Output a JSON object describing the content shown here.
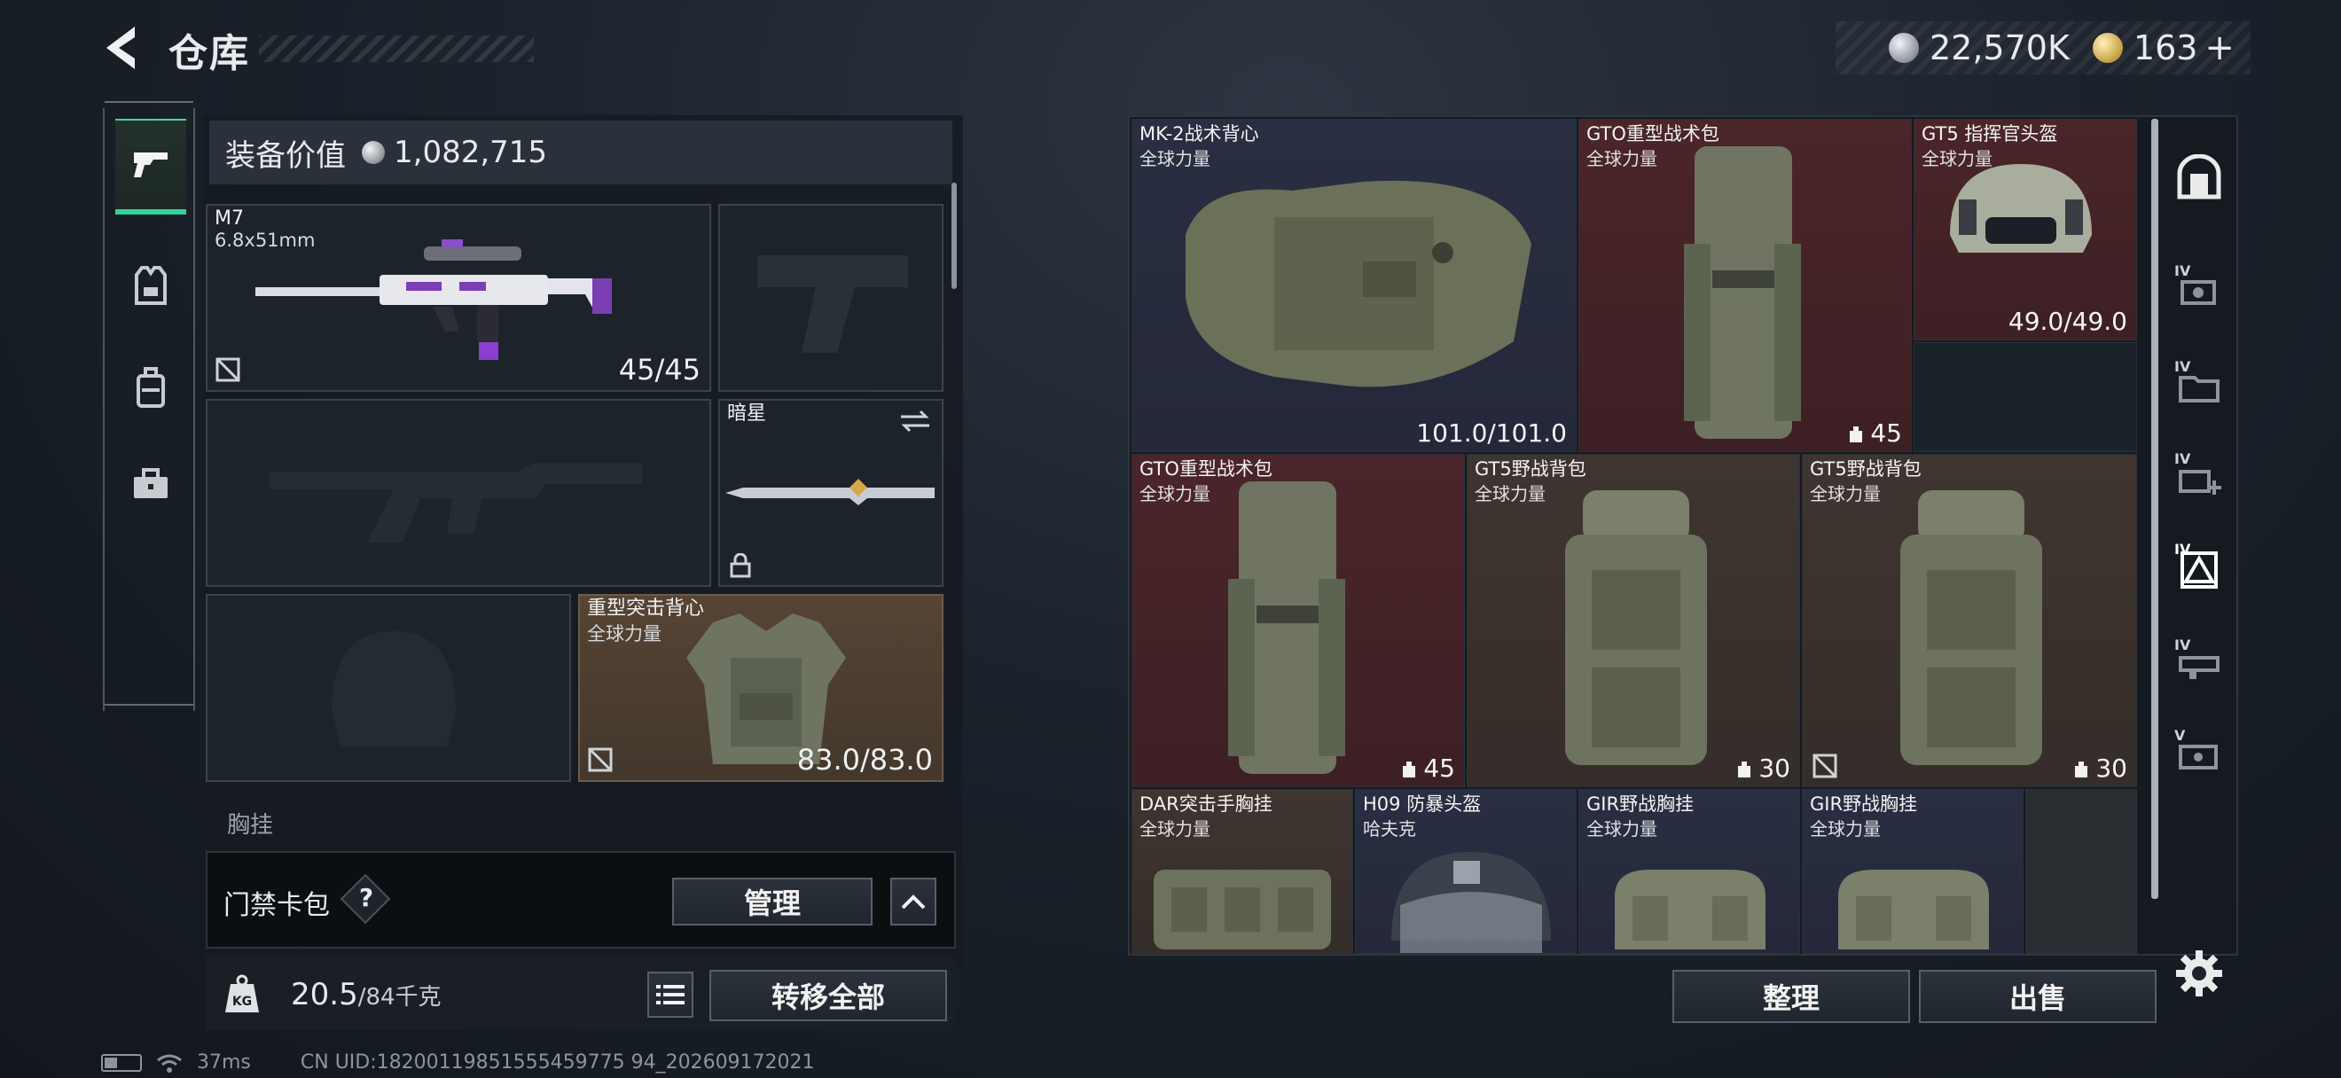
{
  "header": {
    "title": "仓库",
    "currency": [
      {
        "icon": "silver-coin-icon",
        "value": "22,570K"
      },
      {
        "icon": "gold-coin-icon",
        "value": "163"
      },
      {
        "icon": "plus-icon",
        "value": "+"
      }
    ]
  },
  "left_tabs": [
    {
      "icon": "pistol-icon",
      "active": true
    },
    {
      "icon": "vest-icon",
      "active": false
    },
    {
      "icon": "backpack-icon",
      "active": false
    },
    {
      "icon": "toolbox-icon",
      "active": false
    }
  ],
  "loadout": {
    "equip_value_label": "装备价值",
    "equip_value": "1,082,715",
    "primary": {
      "name": "M7",
      "caliber": "6.8x51mm",
      "ammo": "45/45"
    },
    "melee": {
      "name": "暗星"
    },
    "armor": {
      "name": "重型突击背心",
      "sub": "全球力量",
      "durability": "83.0/83.0"
    },
    "peek_label": "胸挂",
    "access_card_label": "门禁卡包",
    "help": "?",
    "manage_button": "管理",
    "weight_value": "20.5",
    "weight_max": "/84千克",
    "transfer_button": "转移全部"
  },
  "storage": {
    "items": [
      {
        "name": "MK-2战术背心",
        "sub": "全球力量",
        "durability": "101.0/101.0",
        "color": "blue"
      },
      {
        "name": "GTO重型战术包",
        "sub": "全球力量",
        "capacity": "45",
        "color": "red"
      },
      {
        "name": "GT5 指挥官头盔",
        "sub": "全球力量",
        "durability": "49.0/49.0",
        "color": "red"
      },
      {
        "name": "GTO重型战术包",
        "sub": "全球力量",
        "capacity": "45",
        "color": "red"
      },
      {
        "name": "GT5野战背包",
        "sub": "全球力量",
        "capacity": "30",
        "color": "tan"
      },
      {
        "name": "GT5野战背包",
        "sub": "全球力量",
        "capacity": "30",
        "color": "tan"
      },
      {
        "name": "DAR突击手胸挂",
        "sub": "全球力量",
        "color": "tan"
      },
      {
        "name": "H09 防暴头盔",
        "sub": "哈夫克",
        "color": "blue"
      },
      {
        "name": "GIR野战胸挂",
        "sub": "全球力量",
        "color": "blue"
      },
      {
        "name": "GIR野战胸挂",
        "sub": "全球力量",
        "color": "blue"
      }
    ],
    "sort_button": "整理",
    "sell_button": "出售"
  },
  "right_rail": [
    {
      "icon": "safe-box-icon"
    },
    {
      "icon": "iv-camera-icon",
      "tag": "IV"
    },
    {
      "icon": "iv-folder-icon",
      "tag": "IV"
    },
    {
      "icon": "iv-add-icon",
      "tag": "IV"
    },
    {
      "icon": "iv-armor-icon",
      "tag": "IV",
      "active": true
    },
    {
      "icon": "iv-gun-icon",
      "tag": "IV"
    },
    {
      "icon": "v-ticket-icon",
      "tag": "V"
    }
  ],
  "status": {
    "ping": "37ms",
    "uid": "CN UID:18200119851555459775 94_202609172021"
  },
  "colors": {
    "accent": "#2fd39b",
    "cell_blue": "#2a2e42",
    "cell_red": "#4b2529",
    "cell_tan": "#3f3530"
  }
}
